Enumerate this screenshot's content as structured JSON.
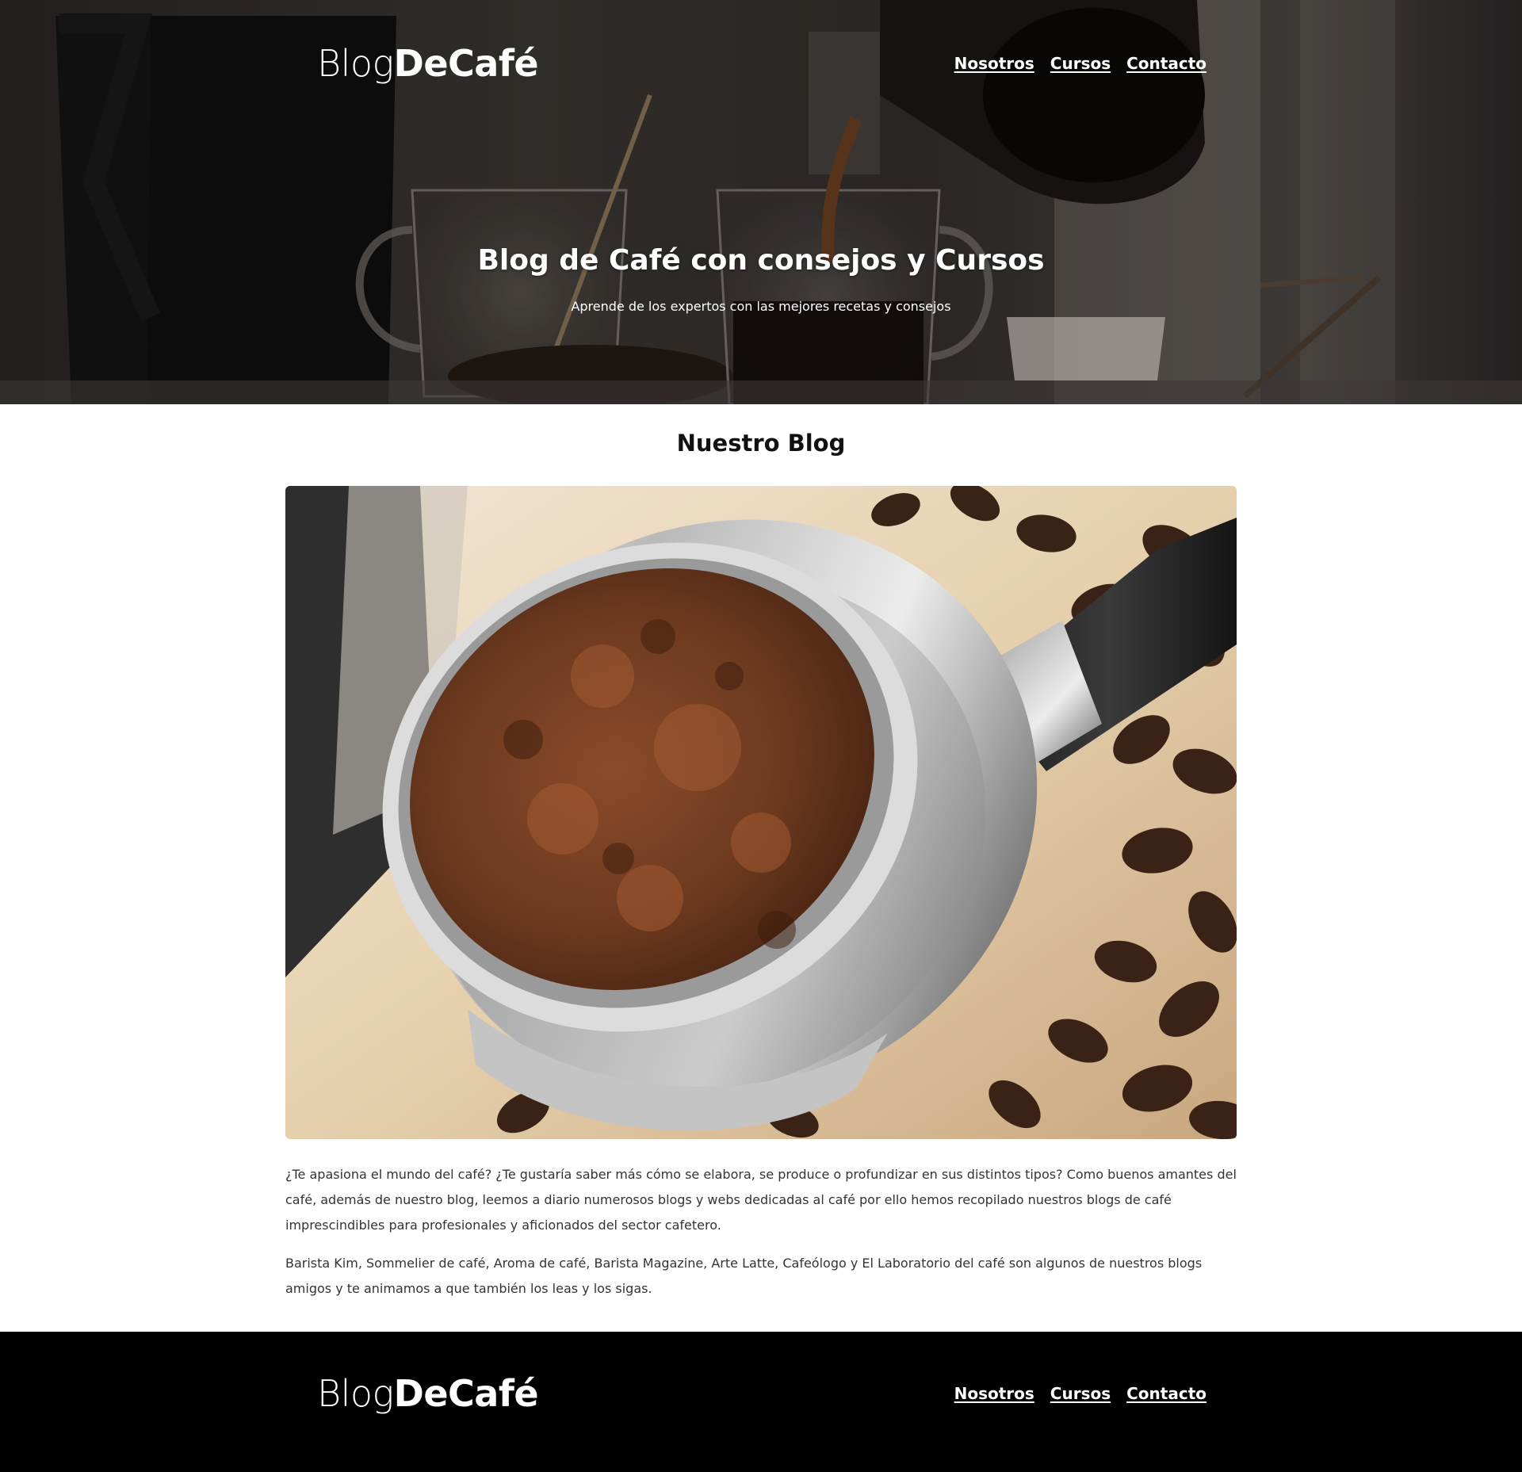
{
  "header": {
    "logo_light": "Blog",
    "logo_bold": "DeCafé",
    "nav": [
      {
        "label": "Nosotros"
      },
      {
        "label": "Cursos"
      },
      {
        "label": "Contacto"
      }
    ]
  },
  "hero": {
    "title": "Blog de Café con consejos y Cursos",
    "subtitle": "Aprende de los expertos con las mejores recetas y consejos"
  },
  "blog": {
    "heading": "Nuestro Blog",
    "paragraphs": [
      "¿Te apasiona el mundo del café? ¿Te gustaría saber más cómo se elabora, se produce o profundizar en sus distintos tipos? Como buenos amantes del café, además de nuestro blog, leemos a diario numerosos blogs y webs dedicadas al café por ello hemos recopilado nuestros blogs de café imprescindibles para profesionales y aficionados del sector cafetero.",
      "Barista Kim, Sommelier de café, Aroma de café, Barista Magazine, Arte Latte, Cafeólogo y El Laboratorio del café son algunos de nuestros blogs amigos y te animamos a que también los leas y los sigas."
    ]
  },
  "footer": {
    "logo_light": "Blog",
    "logo_bold": "DeCafé",
    "nav": [
      {
        "label": "Nosotros"
      },
      {
        "label": "Cursos"
      },
      {
        "label": "Contacto"
      }
    ]
  },
  "colors": {
    "footer_bg": "#000000",
    "text": "#333333",
    "heading": "#111111",
    "nav_text": "#ffffff"
  }
}
